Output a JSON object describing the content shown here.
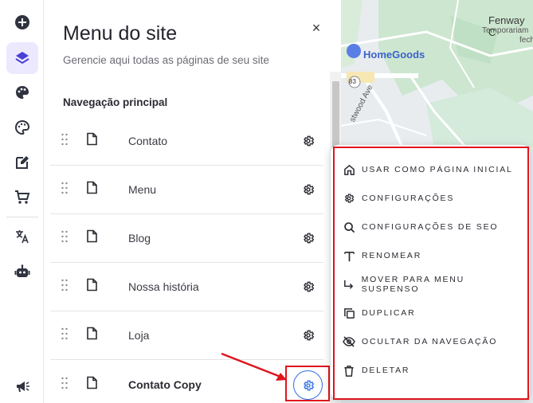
{
  "panel": {
    "title": "Menu do site",
    "subtitle": "Gerencie aqui todas as páginas de seu site",
    "section_title": "Navegação principal",
    "close_symbol": "×"
  },
  "pages": [
    {
      "label": "Contato",
      "bold": false
    },
    {
      "label": "Menu",
      "bold": false
    },
    {
      "label": "Blog",
      "bold": false
    },
    {
      "label": "Nossa história",
      "bold": false
    },
    {
      "label": "Loja",
      "bold": false
    },
    {
      "label": "Contato Copy",
      "bold": true
    }
  ],
  "context_menu": {
    "items": [
      {
        "label": "USAR COMO PÁGINA INICIAL",
        "icon": "home-icon"
      },
      {
        "label": "CONFIGURAÇÕES",
        "icon": "gear-icon"
      },
      {
        "label": "CONFIGURAÇÕES DE SEO",
        "icon": "search-icon"
      },
      {
        "label": "RENOMEAR",
        "icon": "text-icon"
      },
      {
        "label": "MOVER PARA MENU SUSPENSO",
        "icon": "move-down-icon"
      },
      {
        "label": "DUPLICAR",
        "icon": "duplicate-icon"
      },
      {
        "label": "OCULTAR DA NAVEGAÇÃO",
        "icon": "eye-off-icon"
      },
      {
        "label": "DELETAR",
        "icon": "trash-icon"
      }
    ]
  },
  "map": {
    "place_label": "HomeGoods",
    "corner_label_1": "Fenway C",
    "corner_label_2": "Temporariam",
    "corner_label_3": "fech",
    "route_label": "83",
    "street_label": "stwood Ave"
  },
  "rail": {
    "icons": [
      "add-icon",
      "layers-icon",
      "palette-filled-icon",
      "palette-icon",
      "edit-icon",
      "cart-icon",
      "translate-icon",
      "robot-icon",
      "megaphone-icon"
    ]
  },
  "colors": {
    "accent": "#4a3fd6",
    "highlight_red": "#e0141e",
    "active_gear_blue": "#2f6fe0"
  }
}
